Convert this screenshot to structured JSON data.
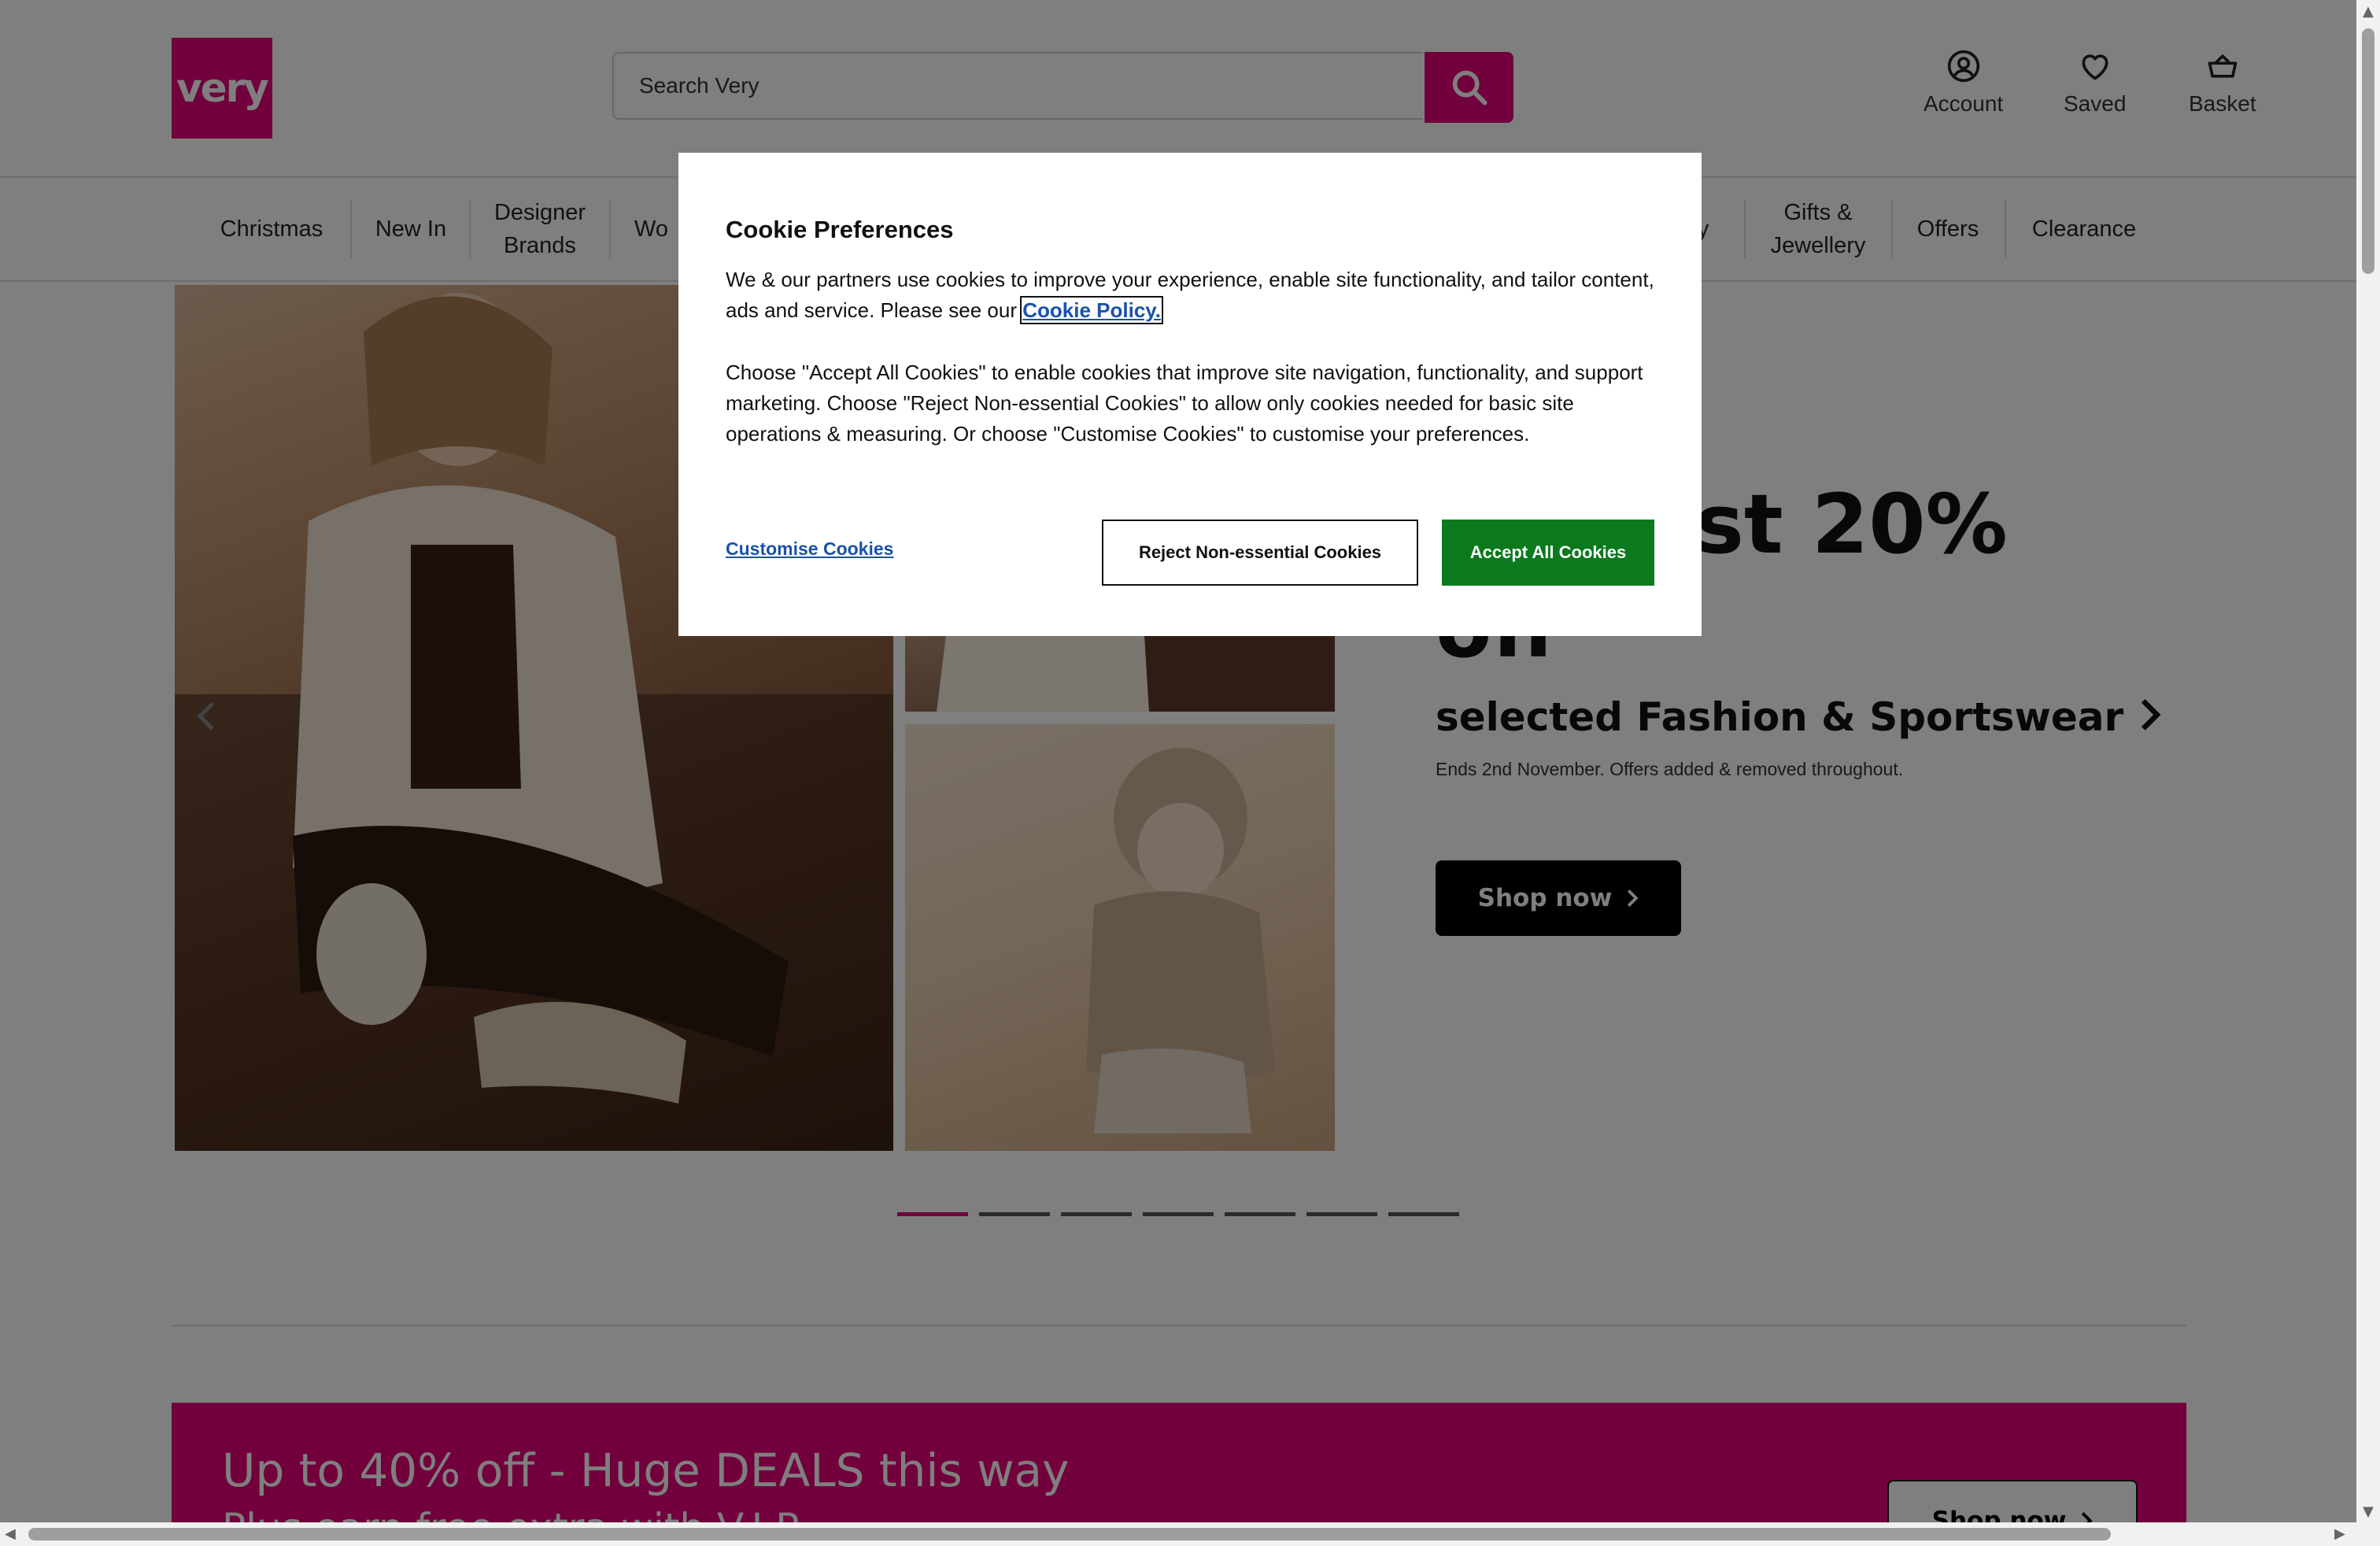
{
  "header": {
    "logo_text": "very",
    "search_placeholder": "Search Very",
    "account_label": "Account",
    "saved_label": "Saved",
    "basket_label": "Basket"
  },
  "nav": {
    "items": [
      "Christmas",
      "New In",
      "Designer Brands",
      "Wo",
      "ty",
      "Gifts & Jewellery",
      "Offers",
      "Clearance"
    ]
  },
  "hero": {
    "title_line1": "st 20%",
    "title_line2": "off",
    "subtitle": "selected Fashion & Sportswear",
    "small_text": "Ends 2nd November. Offers added & removed throughout.",
    "cta_label": "Shop now"
  },
  "promo": {
    "title": "Up to 40% off - Huge DEALS this way",
    "subtitle": "Plus earn free extra with V.I.P.",
    "cta_label": "Shop now"
  },
  "cookie_modal": {
    "title": "Cookie Preferences",
    "para1_text": "We & our partners use cookies to improve your experience, enable site functionality, and tailor content, ads and service. Please see our",
    "policy_link": "Cookie Policy.",
    "para2": "Choose \"Accept All Cookies\" to enable cookies that improve site navigation, functionality, and support marketing. Choose \"Reject Non-essential Cookies\" to allow only cookies needed for basic site operations & measuring. Or choose \"Customise Cookies\" to customise your preferences.",
    "customise_label": "Customise Cookies",
    "reject_label": "Reject Non-essential Cookies",
    "accept_label": "Accept All Cookies"
  },
  "carousel": {
    "active_slide": 1,
    "slide_count": 7
  },
  "colors": {
    "brand": "#e3007b",
    "accept": "#0a7a1d",
    "link": "#1a52a8"
  }
}
